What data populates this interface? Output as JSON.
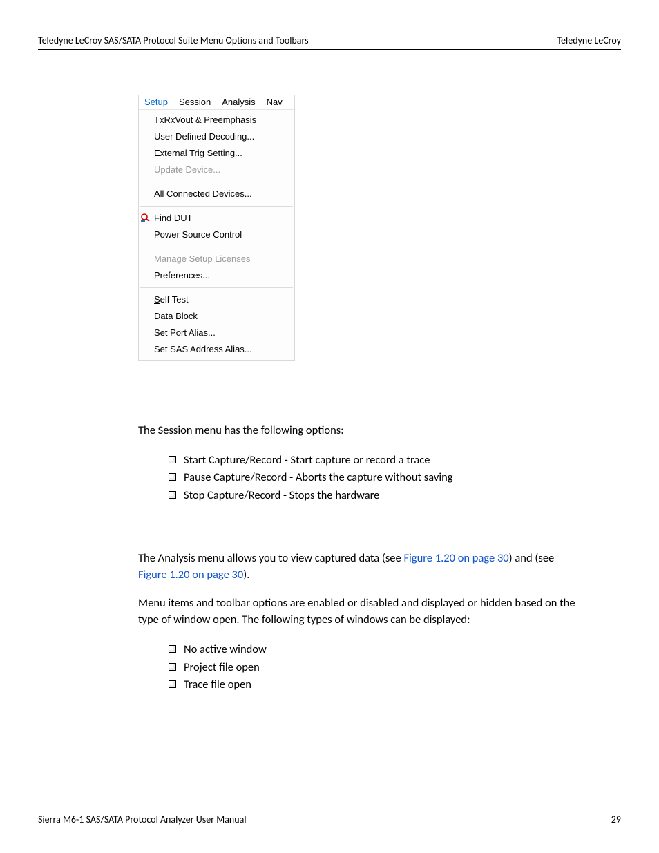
{
  "header": {
    "left": "Teledyne LeCroy SAS/SATA Protocol Suite Menu Options and Toolbars",
    "right": "Teledyne LeCroy"
  },
  "menubar": {
    "setup": "Setup",
    "session": "Session",
    "analysis": "Analysis",
    "nav": "Nav"
  },
  "menu": {
    "g1": {
      "txrx": "TxRxVout & Preemphasis",
      "udd": "User Defined Decoding...",
      "ext": "External Trig Setting...",
      "upd": "Update Device..."
    },
    "g2": {
      "all": "All Connected Devices..."
    },
    "g3": {
      "find": "Find DUT",
      "psc": "Power Source Control"
    },
    "g4": {
      "lic": "Manage Setup Licenses",
      "pref": "Preferences..."
    },
    "g5": {
      "self": "Self Test",
      "db": "Data Block",
      "spa": "Set Port Alias...",
      "ssa": "Set SAS Address Alias..."
    }
  },
  "paragraphs": {
    "session_intro": "The Session menu has the following options:",
    "analysis_pre": "The Analysis menu allows you to view captured data (see ",
    "analysis_link1": "Figure 1.20 on page 30",
    "analysis_mid": ") and (see ",
    "analysis_link2": "Figure 1.20 on page 30",
    "analysis_post": ").",
    "menuitems": "Menu items and toolbar options are enabled or disabled and displayed or hidden based on the type of window open. The following types of windows can be displayed:"
  },
  "session_list": {
    "i1": "Start Capture/Record - Start capture or record a trace",
    "i2": "Pause Capture/Record - Aborts the capture without saving",
    "i3": "Stop Capture/Record - Stops the hardware"
  },
  "window_list": {
    "i1": "No active window",
    "i2": "Project file open",
    "i3": "Trace file open"
  },
  "footer": {
    "left": "Sierra M6-1 SAS/SATA Protocol Analyzer User Manual",
    "right": "29"
  }
}
